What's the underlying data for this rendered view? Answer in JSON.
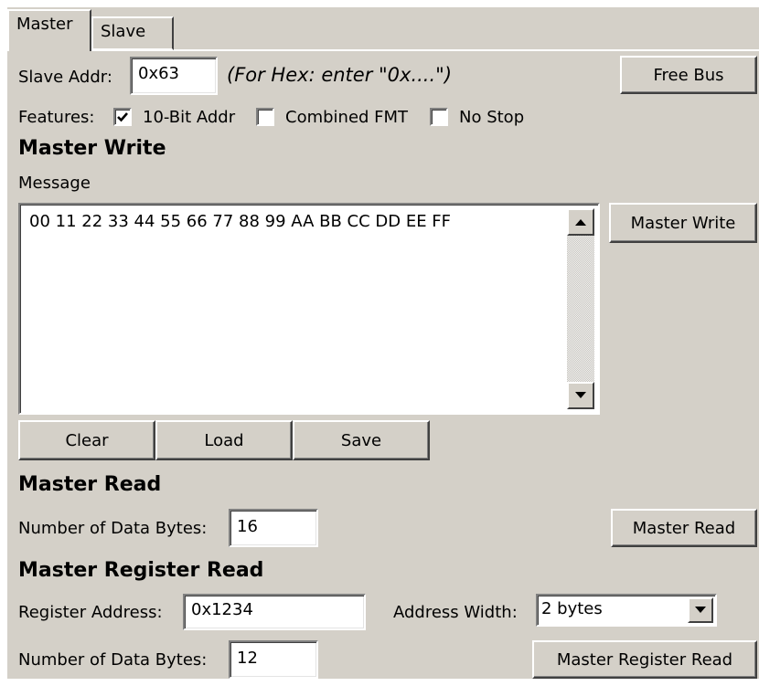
{
  "tabs": [
    {
      "label": "Master",
      "active": true
    },
    {
      "label": "Slave",
      "active": false
    }
  ],
  "slave_addr": {
    "label": "Slave Addr:",
    "value": "0x63",
    "hint": "(For Hex: enter \"0x....\")"
  },
  "free_bus_label": "Free Bus",
  "features": {
    "label": "Features:",
    "options": [
      {
        "label": "10-Bit Addr",
        "checked": true
      },
      {
        "label": "Combined FMT",
        "checked": false
      },
      {
        "label": "No Stop",
        "checked": false
      }
    ]
  },
  "master_write": {
    "heading": "Master Write",
    "message_label": "Message",
    "message": "00 11 22 33 44 55 66 77 88 99 AA BB CC DD EE FF",
    "button_label": "Master Write",
    "clear_label": "Clear",
    "load_label": "Load",
    "save_label": "Save"
  },
  "master_read": {
    "heading": "Master Read",
    "bytes_label": "Number of Data Bytes:",
    "bytes_value": "16",
    "button_label": "Master Read"
  },
  "master_register_read": {
    "heading": "Master Register Read",
    "reg_label": "Register Address:",
    "reg_value": "0x1234",
    "width_label": "Address Width:",
    "width_value": "2 bytes",
    "bytes_label": "Number of Data Bytes:",
    "bytes_value": "12",
    "button_label": "Master Register Read"
  },
  "colors": {
    "panel": "#d4d0c8",
    "field": "#ffffff"
  },
  "icons": [
    "checkmark-icon",
    "scroll-up-arrow-icon",
    "scroll-down-arrow-icon",
    "dropdown-arrow-icon"
  ]
}
